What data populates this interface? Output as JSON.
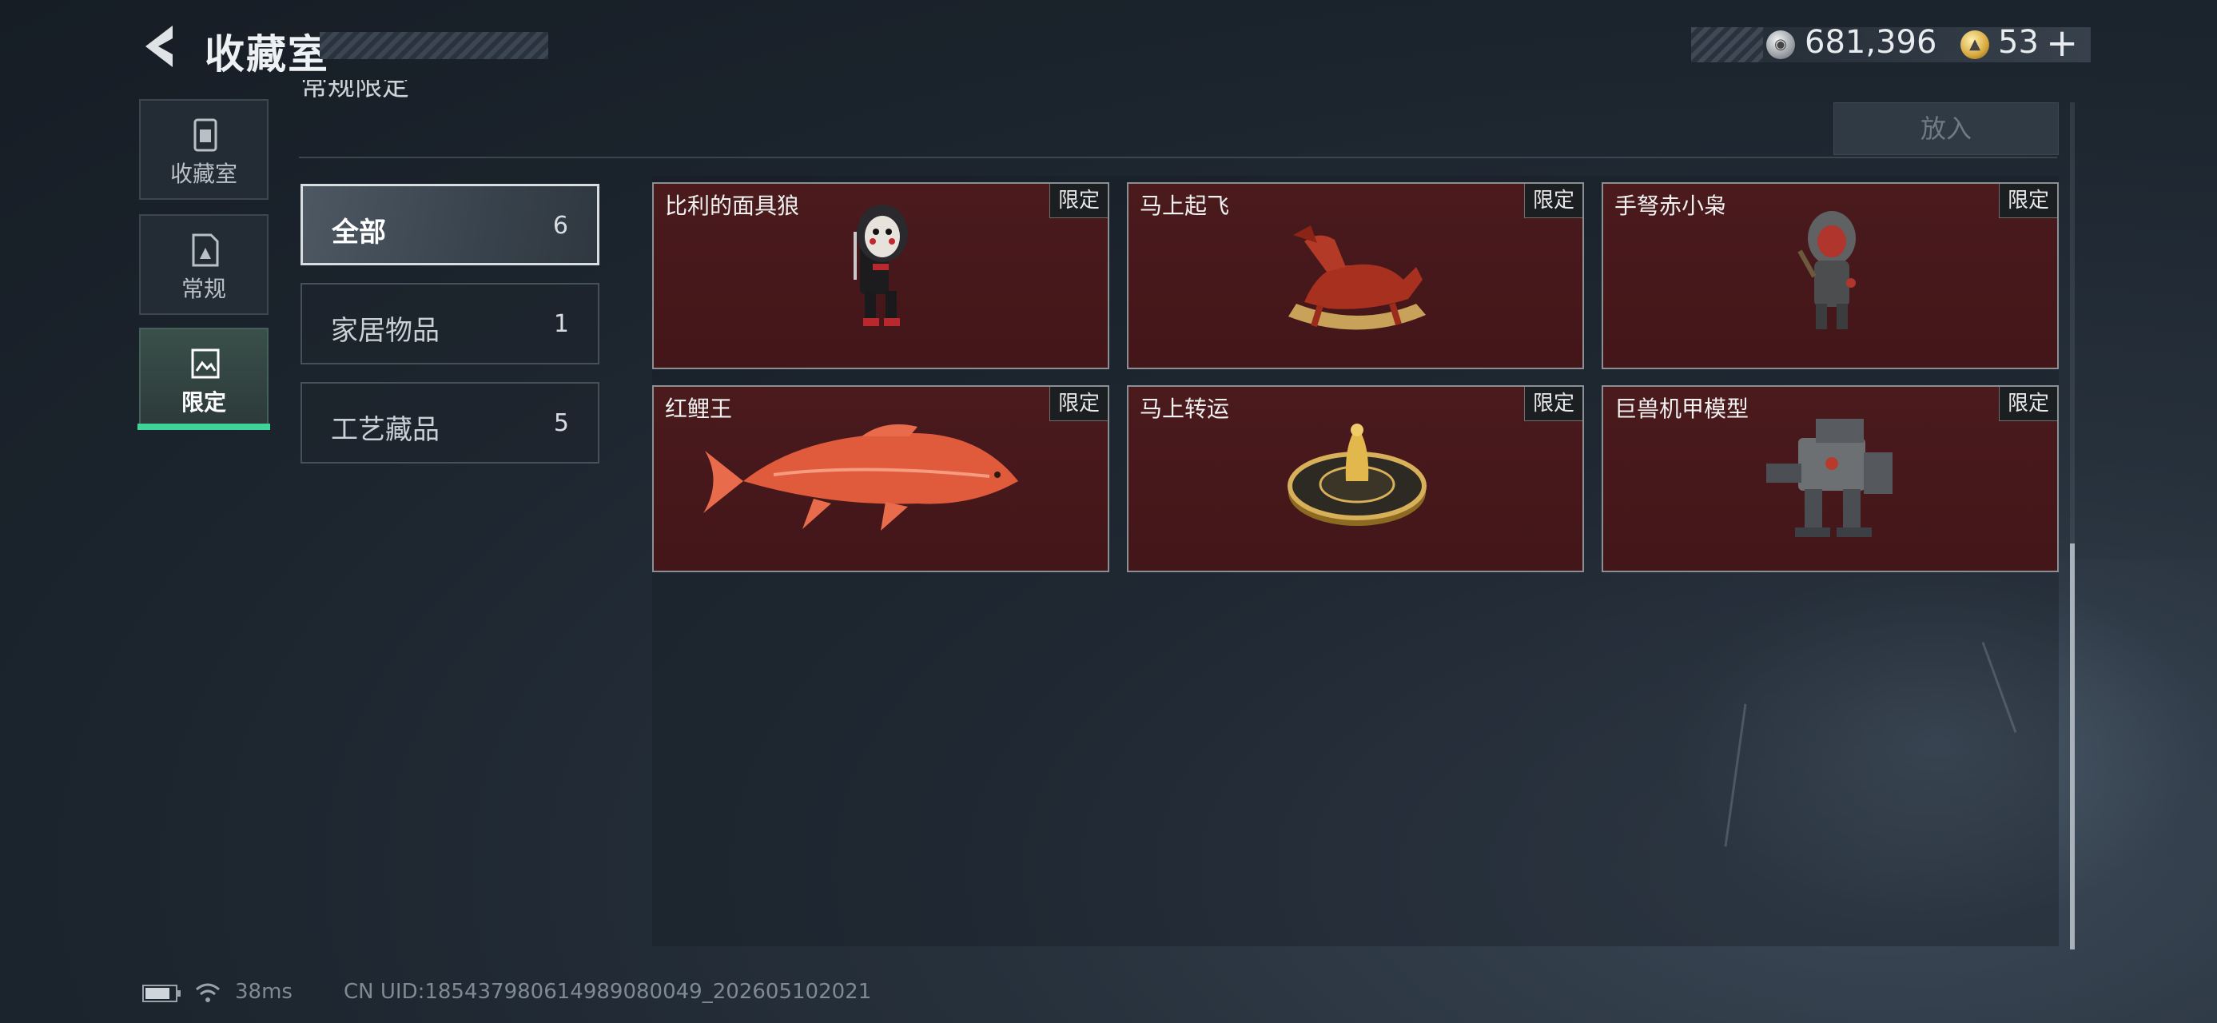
{
  "header": {
    "title": "收藏室",
    "currency_silver": "681,396",
    "currency_gold": "53",
    "add_label": "+"
  },
  "nav": {
    "items": [
      {
        "label": "收藏室",
        "icon": "trash-bin-icon"
      },
      {
        "label": "常规",
        "icon": "document-icon"
      },
      {
        "label": "限定",
        "icon": "image-icon"
      }
    ],
    "active_index": 2
  },
  "section": {
    "label": "常规限定",
    "put_button": "放入"
  },
  "categories": [
    {
      "name": "全部",
      "count": "6"
    },
    {
      "name": "家居物品",
      "count": "1"
    },
    {
      "name": "工艺藏品",
      "count": "5"
    }
  ],
  "items": [
    {
      "name": "比利的面具狼",
      "tag": "限定"
    },
    {
      "name": "马上起飞",
      "tag": "限定"
    },
    {
      "name": "手弩赤小枭",
      "tag": "限定"
    },
    {
      "name": "红鲤王",
      "tag": "限定"
    },
    {
      "name": "马上转运",
      "tag": "限定"
    },
    {
      "name": "巨兽机甲模型",
      "tag": "限定"
    }
  ],
  "status": {
    "ping": "38ms",
    "uid": "CN UID:18543798061498908004​9_202605102021"
  },
  "colors": {
    "accent_green": "#3fd39a",
    "card_bg": "#4a1a1d"
  }
}
